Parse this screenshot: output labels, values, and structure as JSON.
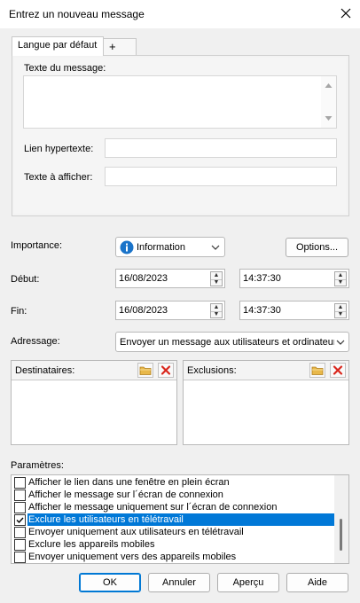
{
  "window": {
    "title": "Entrez un nouveau message"
  },
  "tabs": [
    {
      "label": "Langue par défaut"
    },
    {
      "label": "+"
    }
  ],
  "message": {
    "text_label": "Texte du message:",
    "text_value": "",
    "link_label": "Lien hypertexte:",
    "link_value": "",
    "display_label": "Texte à afficher:",
    "display_value": ""
  },
  "importance": {
    "label": "Importance:",
    "value": "Information",
    "options_button": "Options..."
  },
  "start": {
    "label": "Début:",
    "date": "16/08/2023",
    "time": "14:37:30"
  },
  "end": {
    "label": "Fin:",
    "date": "16/08/2023",
    "time": "14:37:30"
  },
  "addressing": {
    "label": "Adressage:",
    "value": "Envoyer un message aux utilisateurs et ordinateurs"
  },
  "recipients": {
    "label": "Destinataires:"
  },
  "exclusions": {
    "label": "Exclusions:"
  },
  "parameters": {
    "label": "Paramètres:",
    "items": [
      {
        "label": "Afficher le lien dans une fenêtre en plein écran",
        "checked": false,
        "selected": false
      },
      {
        "label": "Afficher le message sur l´écran de connexion",
        "checked": false,
        "selected": false
      },
      {
        "label": "Afficher le message uniquement sur l´écran de connexion",
        "checked": false,
        "selected": false
      },
      {
        "label": "Exclure les utilisateurs en télétravail",
        "checked": true,
        "selected": true
      },
      {
        "label": "Envoyer uniquement aux utilisateurs en télétravail",
        "checked": false,
        "selected": false
      },
      {
        "label": "Exclure les appareils mobiles",
        "checked": false,
        "selected": false
      },
      {
        "label": "Envoyer uniquement vers des appareils mobiles",
        "checked": false,
        "selected": false
      }
    ]
  },
  "buttons": {
    "ok": "OK",
    "cancel": "Annuler",
    "preview": "Aperçu",
    "help": "Aide"
  },
  "colors": {
    "accent": "#0078d7",
    "info_icon": "#1a73c9",
    "delete_icon": "#d9261c",
    "folder_icon": "#e8b84a"
  }
}
